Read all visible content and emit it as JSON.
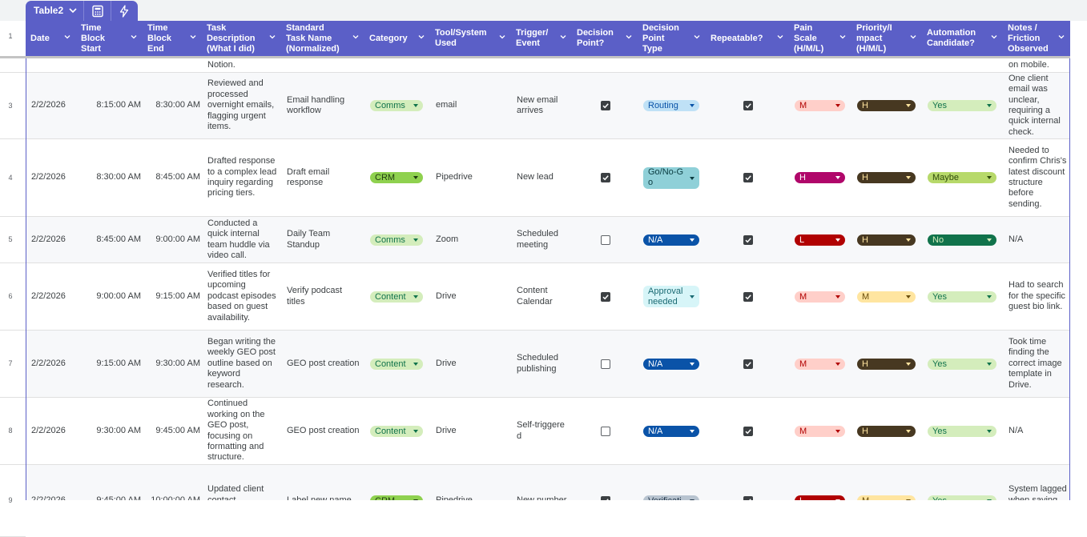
{
  "table": {
    "name": "Table2",
    "icons": [
      "chevron-down-icon",
      "calculator-icon",
      "bolt-icon"
    ]
  },
  "header_row_number": "1",
  "columns": [
    {
      "key": "date",
      "label": "Date"
    },
    {
      "key": "start",
      "label": "Time\nBlock\nStart"
    },
    {
      "key": "end",
      "label": "Time\nBlock\nEnd"
    },
    {
      "key": "desc",
      "label": "Task\nDescription\n(What I did)"
    },
    {
      "key": "std",
      "label": "Standard\nTask Name\n(Normalized)"
    },
    {
      "key": "cat",
      "label": "Category"
    },
    {
      "key": "tool",
      "label": "Tool/System\nUsed"
    },
    {
      "key": "trig",
      "label": "Trigger/\nEvent"
    },
    {
      "key": "dp",
      "label": "Decision\nPoint?"
    },
    {
      "key": "dpt",
      "label": "Decision\nPoint\nType"
    },
    {
      "key": "rep",
      "label": "Repeatable?"
    },
    {
      "key": "pain",
      "label": "Pain\nScale\n(H/M/L)"
    },
    {
      "key": "pri",
      "label": "Priority/I\nmpact\n(H/M/L)"
    },
    {
      "key": "auto",
      "label": "Automation\nCandidate?"
    },
    {
      "key": "notes",
      "label": "Notes /\nFriction\nObserved"
    }
  ],
  "partial_row": {
    "desc_tail": "Notion.",
    "notes_tail": "on mobile."
  },
  "rows": [
    {
      "num": "3",
      "date": "2/2/2026",
      "start": "8:15:00 AM",
      "end": "8:30:00 AM",
      "desc": "Reviewed and processed overnight emails, flagging urgent items.",
      "std": "Email handling workflow",
      "cat": "Comms",
      "tool": "email",
      "trig": "New email arrives",
      "dp": true,
      "dpt": "Routing",
      "rep": true,
      "pain": "M",
      "pri": "H",
      "auto": "Yes",
      "notes": "One client email was unclear, requiring a quick internal check."
    },
    {
      "num": "4",
      "date": "2/2/2026",
      "start": "8:30:00 AM",
      "end": "8:45:00 AM",
      "desc": "Drafted response to a complex lead inquiry regarding pricing tiers.",
      "std": "Draft email response",
      "cat": "CRM",
      "tool": "Pipedrive",
      "trig": "New lead",
      "dp": true,
      "dpt": "Go/No-G o",
      "rep": true,
      "pain": "H",
      "pri": "H",
      "auto": "Maybe",
      "notes": "Needed to confirm Chris's latest discount structure before sending."
    },
    {
      "num": "5",
      "date": "2/2/2026",
      "start": "8:45:00 AM",
      "end": "9:00:00 AM",
      "desc": "Conducted a quick internal team huddle via video call.",
      "std": "Daily Team Standup",
      "cat": "Comms",
      "tool": "Zoom",
      "trig": "Scheduled meeting",
      "dp": false,
      "dpt": "N/A",
      "rep": true,
      "pain": "L",
      "pri": "H",
      "auto": "No",
      "notes": "N/A"
    },
    {
      "num": "6",
      "date": "2/2/2026",
      "start": "9:00:00 AM",
      "end": "9:15:00 AM",
      "desc": "Verified titles for upcoming podcast episodes based on guest availability.",
      "std": "Verify podcast titles",
      "cat": "Content",
      "tool": "Drive",
      "trig": "Content Calendar",
      "dp": true,
      "dpt": "Approval needed",
      "rep": true,
      "pain": "M",
      "pri": "M",
      "auto": "Yes",
      "notes": "Had to search for the specific guest bio link."
    },
    {
      "num": "7",
      "date": "2/2/2026",
      "start": "9:15:00 AM",
      "end": "9:30:00 AM",
      "desc": "Began writing the weekly GEO post outline based on keyword research.",
      "std": "GEO post creation",
      "cat": "Content",
      "tool": "Drive",
      "trig": "Scheduled publishing",
      "dp": false,
      "dpt": "N/A",
      "rep": true,
      "pain": "M",
      "pri": "H",
      "auto": "Yes",
      "notes": "Took time finding the correct image template in Drive."
    },
    {
      "num": "8",
      "date": "2/2/2026",
      "start": "9:30:00 AM",
      "end": "9:45:00 AM",
      "desc": "Continued working on the GEO post, focusing on formatting and structure.",
      "std": "GEO post creation",
      "cat": "Content",
      "tool": "Drive",
      "trig": "Self-triggere d",
      "dp": false,
      "dpt": "N/A",
      "rep": true,
      "pain": "M",
      "pri": "H",
      "auto": "Yes",
      "notes": "N/A"
    },
    {
      "num": "9",
      "date": "2/2/2026",
      "start": "9:45:00 AM",
      "end": "10:00:00 AM",
      "desc": "Updated client contact information in",
      "std": "Label new name",
      "cat": "CRM",
      "tool": "Pipedrive",
      "trig": "New number",
      "dp": true,
      "dpt": "Verificati",
      "rep": true,
      "pain": "L",
      "pri": "M",
      "auto": "Yes",
      "notes": "System lagged when saving the"
    }
  ],
  "colors": {
    "header_bg": "#5b5fc7",
    "cat": {
      "Comms": {
        "bg": "#d4edbc",
        "fg": "#11734b"
      },
      "CRM": {
        "bg": "#8fd14f",
        "fg": "#1e3a0f"
      },
      "Content": {
        "bg": "#d4edbc",
        "fg": "#11734b"
      }
    },
    "dpt": {
      "Routing": {
        "bg": "#bfe1f6",
        "fg": "#0a53a8"
      },
      "Go/No-G o": {
        "bg": "#8fd0d8",
        "fg": "#0b3c41"
      },
      "N/A": {
        "bg": "#0a53a8",
        "fg": "#ffffff"
      },
      "Approval needed": {
        "bg": "#d7f5f8",
        "fg": "#1a6a73"
      },
      "Verificati": {
        "bg": "#b8c4d0",
        "fg": "#24384c"
      }
    },
    "pain": {
      "M": {
        "bg": "#ffcfc9",
        "fg": "#b10202"
      },
      "H": {
        "bg": "#b0076a",
        "fg": "#ffffff"
      },
      "L": {
        "bg": "#b10202",
        "fg": "#ffffff"
      }
    },
    "pri": {
      "H": {
        "bg": "#473821",
        "fg": "#ffe5a0"
      },
      "M": {
        "bg": "#ffe5a0",
        "fg": "#6b4e0c"
      }
    },
    "auto": {
      "Yes": {
        "bg": "#d4edbc",
        "fg": "#11734b"
      },
      "Maybe": {
        "bg": "#b7d96a",
        "fg": "#2f4a0c"
      },
      "No": {
        "bg": "#11734b",
        "fg": "#d4edbc"
      }
    }
  }
}
